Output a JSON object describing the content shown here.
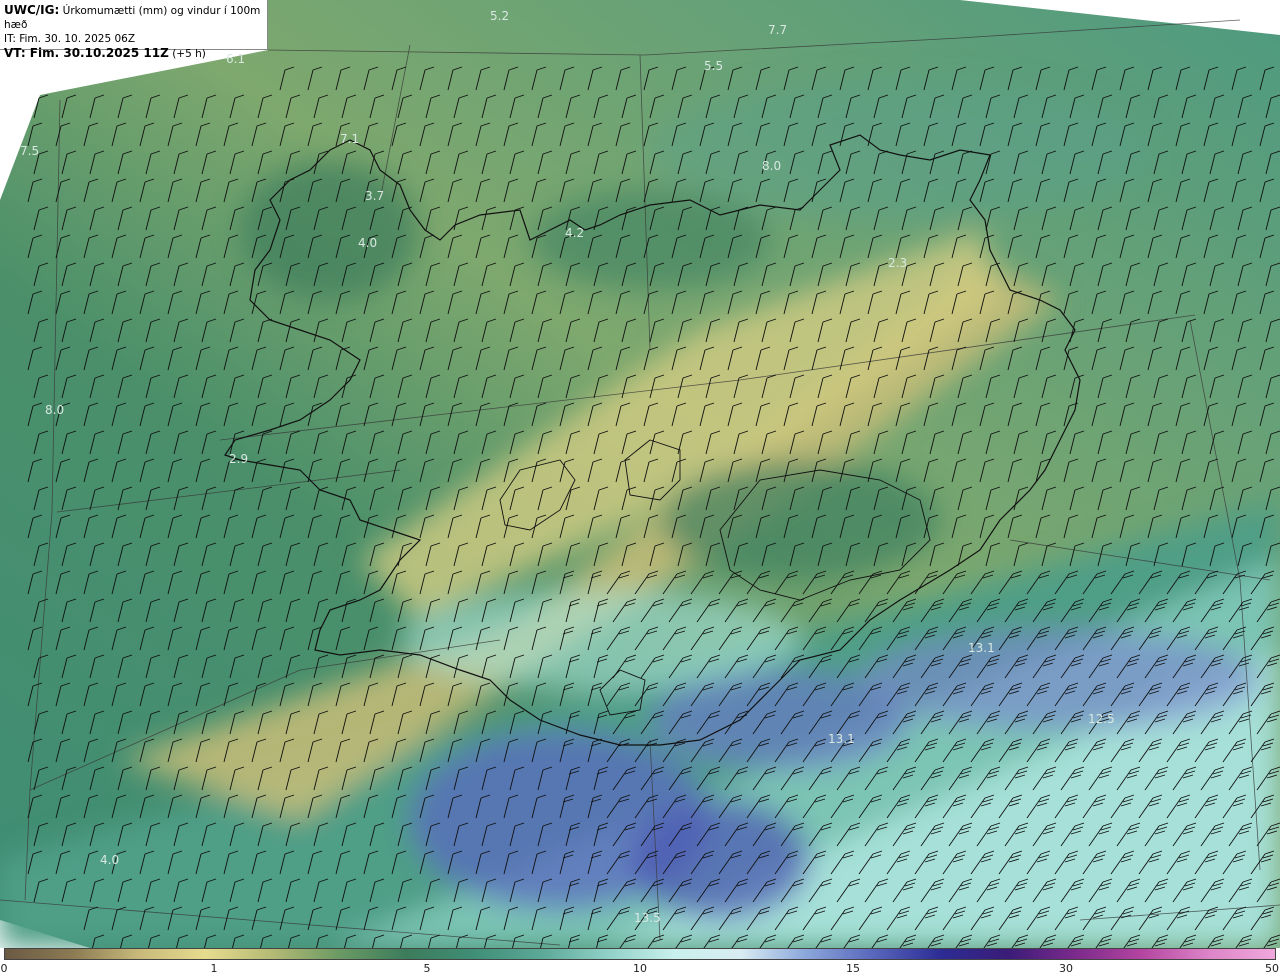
{
  "header": {
    "model": "UWC/IG:",
    "title": "Úrkomumætti (mm) og vindur í 100m hæð",
    "init_time": "IT: Fim. 30. 10. 2025 06Z",
    "valid_label": "VT: Fim. 30.10.2025 11Z",
    "valid_offset": "(+5 h)"
  },
  "colorbar": {
    "ticks": [
      "0",
      "1",
      "5",
      "10",
      "15",
      "30",
      "50"
    ],
    "colors": [
      "#6b5a43",
      "#8b7a52",
      "#c8b97a",
      "#e6dc8e",
      "#b4ba74",
      "#6b9a64",
      "#3c7c5c",
      "#3f8e76",
      "#5aa896",
      "#8fd0c6",
      "#c8f0ec",
      "#d8ecf2",
      "#8aa6da",
      "#5866bc",
      "#2c2c94",
      "#3a1c78",
      "#7a2a8c",
      "#b444a0",
      "#dc84c8",
      "#f0a8dc"
    ]
  },
  "value_labels": [
    "5.2",
    "7.7",
    "6.1",
    "5.5",
    "7.1",
    "8.0",
    "3.7",
    "7.5",
    "4.2",
    "4.0",
    "2.3",
    "8.0",
    "2.9",
    "13.1",
    "12.5",
    "13.1",
    "4.0",
    "13.5"
  ],
  "wind_barbs": {
    "units": "kt",
    "direction": "W-SW to SW"
  }
}
